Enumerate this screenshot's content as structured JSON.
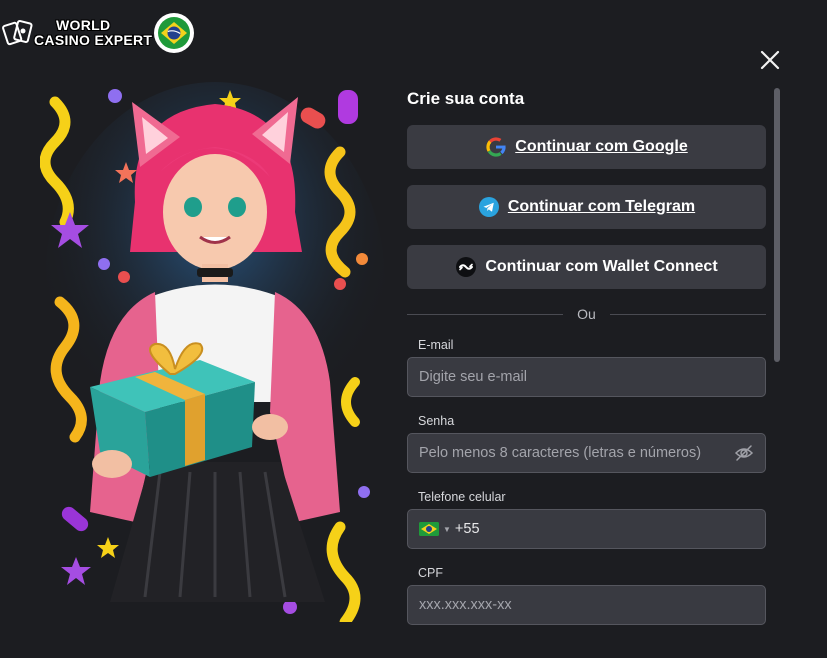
{
  "logo": {
    "line1": "WORLD",
    "line2": "CASINO EXPERT"
  },
  "form": {
    "title": "Crie sua conta",
    "google_label": "Continuar com Google",
    "telegram_label": "Continuar com Telegram",
    "wallet_label": "Continuar com Wallet Connect",
    "divider": "Ou",
    "email": {
      "label": "E-mail",
      "placeholder": "Digite seu e-mail"
    },
    "password": {
      "label": "Senha",
      "placeholder": "Pelo menos 8 caracteres (letras e números)"
    },
    "phone": {
      "label": "Telefone celular",
      "country_code": "+55"
    },
    "cpf": {
      "label": "CPF",
      "placeholder": "xxx.xxx.xxx-xx"
    }
  },
  "colors": {
    "background": "#1c1d21",
    "button": "#3a3b42",
    "field": "#393a41",
    "telegram": "#2aa3df",
    "accent_pink": "#e8457a"
  },
  "icons": [
    "close-icon",
    "google-icon",
    "telegram-icon",
    "wallet-connect-icon",
    "eye-off-icon",
    "brazil-flag-icon"
  ]
}
